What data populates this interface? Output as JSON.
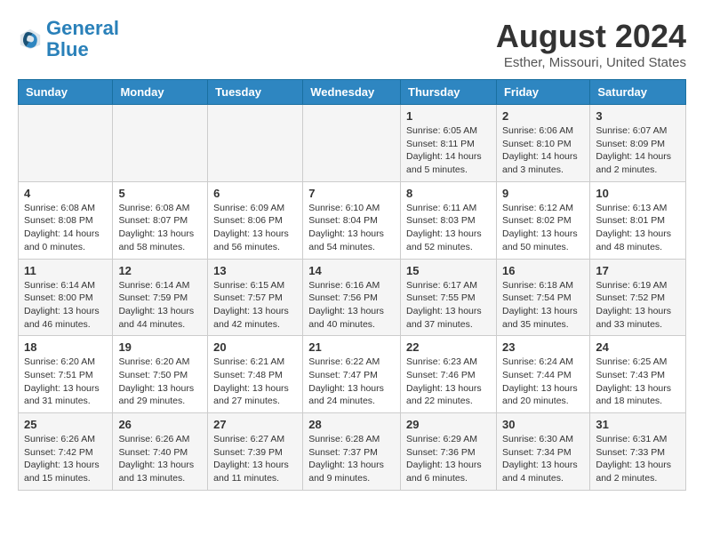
{
  "header": {
    "logo_line1": "General",
    "logo_line2": "Blue",
    "month_year": "August 2024",
    "location": "Esther, Missouri, United States"
  },
  "weekdays": [
    "Sunday",
    "Monday",
    "Tuesday",
    "Wednesday",
    "Thursday",
    "Friday",
    "Saturday"
  ],
  "weeks": [
    [
      {
        "day": "",
        "info": ""
      },
      {
        "day": "",
        "info": ""
      },
      {
        "day": "",
        "info": ""
      },
      {
        "day": "",
        "info": ""
      },
      {
        "day": "1",
        "info": "Sunrise: 6:05 AM\nSunset: 8:11 PM\nDaylight: 14 hours\nand 5 minutes."
      },
      {
        "day": "2",
        "info": "Sunrise: 6:06 AM\nSunset: 8:10 PM\nDaylight: 14 hours\nand 3 minutes."
      },
      {
        "day": "3",
        "info": "Sunrise: 6:07 AM\nSunset: 8:09 PM\nDaylight: 14 hours\nand 2 minutes."
      }
    ],
    [
      {
        "day": "4",
        "info": "Sunrise: 6:08 AM\nSunset: 8:08 PM\nDaylight: 14 hours\nand 0 minutes."
      },
      {
        "day": "5",
        "info": "Sunrise: 6:08 AM\nSunset: 8:07 PM\nDaylight: 13 hours\nand 58 minutes."
      },
      {
        "day": "6",
        "info": "Sunrise: 6:09 AM\nSunset: 8:06 PM\nDaylight: 13 hours\nand 56 minutes."
      },
      {
        "day": "7",
        "info": "Sunrise: 6:10 AM\nSunset: 8:04 PM\nDaylight: 13 hours\nand 54 minutes."
      },
      {
        "day": "8",
        "info": "Sunrise: 6:11 AM\nSunset: 8:03 PM\nDaylight: 13 hours\nand 52 minutes."
      },
      {
        "day": "9",
        "info": "Sunrise: 6:12 AM\nSunset: 8:02 PM\nDaylight: 13 hours\nand 50 minutes."
      },
      {
        "day": "10",
        "info": "Sunrise: 6:13 AM\nSunset: 8:01 PM\nDaylight: 13 hours\nand 48 minutes."
      }
    ],
    [
      {
        "day": "11",
        "info": "Sunrise: 6:14 AM\nSunset: 8:00 PM\nDaylight: 13 hours\nand 46 minutes."
      },
      {
        "day": "12",
        "info": "Sunrise: 6:14 AM\nSunset: 7:59 PM\nDaylight: 13 hours\nand 44 minutes."
      },
      {
        "day": "13",
        "info": "Sunrise: 6:15 AM\nSunset: 7:57 PM\nDaylight: 13 hours\nand 42 minutes."
      },
      {
        "day": "14",
        "info": "Sunrise: 6:16 AM\nSunset: 7:56 PM\nDaylight: 13 hours\nand 40 minutes."
      },
      {
        "day": "15",
        "info": "Sunrise: 6:17 AM\nSunset: 7:55 PM\nDaylight: 13 hours\nand 37 minutes."
      },
      {
        "day": "16",
        "info": "Sunrise: 6:18 AM\nSunset: 7:54 PM\nDaylight: 13 hours\nand 35 minutes."
      },
      {
        "day": "17",
        "info": "Sunrise: 6:19 AM\nSunset: 7:52 PM\nDaylight: 13 hours\nand 33 minutes."
      }
    ],
    [
      {
        "day": "18",
        "info": "Sunrise: 6:20 AM\nSunset: 7:51 PM\nDaylight: 13 hours\nand 31 minutes."
      },
      {
        "day": "19",
        "info": "Sunrise: 6:20 AM\nSunset: 7:50 PM\nDaylight: 13 hours\nand 29 minutes."
      },
      {
        "day": "20",
        "info": "Sunrise: 6:21 AM\nSunset: 7:48 PM\nDaylight: 13 hours\nand 27 minutes."
      },
      {
        "day": "21",
        "info": "Sunrise: 6:22 AM\nSunset: 7:47 PM\nDaylight: 13 hours\nand 24 minutes."
      },
      {
        "day": "22",
        "info": "Sunrise: 6:23 AM\nSunset: 7:46 PM\nDaylight: 13 hours\nand 22 minutes."
      },
      {
        "day": "23",
        "info": "Sunrise: 6:24 AM\nSunset: 7:44 PM\nDaylight: 13 hours\nand 20 minutes."
      },
      {
        "day": "24",
        "info": "Sunrise: 6:25 AM\nSunset: 7:43 PM\nDaylight: 13 hours\nand 18 minutes."
      }
    ],
    [
      {
        "day": "25",
        "info": "Sunrise: 6:26 AM\nSunset: 7:42 PM\nDaylight: 13 hours\nand 15 minutes."
      },
      {
        "day": "26",
        "info": "Sunrise: 6:26 AM\nSunset: 7:40 PM\nDaylight: 13 hours\nand 13 minutes."
      },
      {
        "day": "27",
        "info": "Sunrise: 6:27 AM\nSunset: 7:39 PM\nDaylight: 13 hours\nand 11 minutes."
      },
      {
        "day": "28",
        "info": "Sunrise: 6:28 AM\nSunset: 7:37 PM\nDaylight: 13 hours\nand 9 minutes."
      },
      {
        "day": "29",
        "info": "Sunrise: 6:29 AM\nSunset: 7:36 PM\nDaylight: 13 hours\nand 6 minutes."
      },
      {
        "day": "30",
        "info": "Sunrise: 6:30 AM\nSunset: 7:34 PM\nDaylight: 13 hours\nand 4 minutes."
      },
      {
        "day": "31",
        "info": "Sunrise: 6:31 AM\nSunset: 7:33 PM\nDaylight: 13 hours\nand 2 minutes."
      }
    ]
  ]
}
